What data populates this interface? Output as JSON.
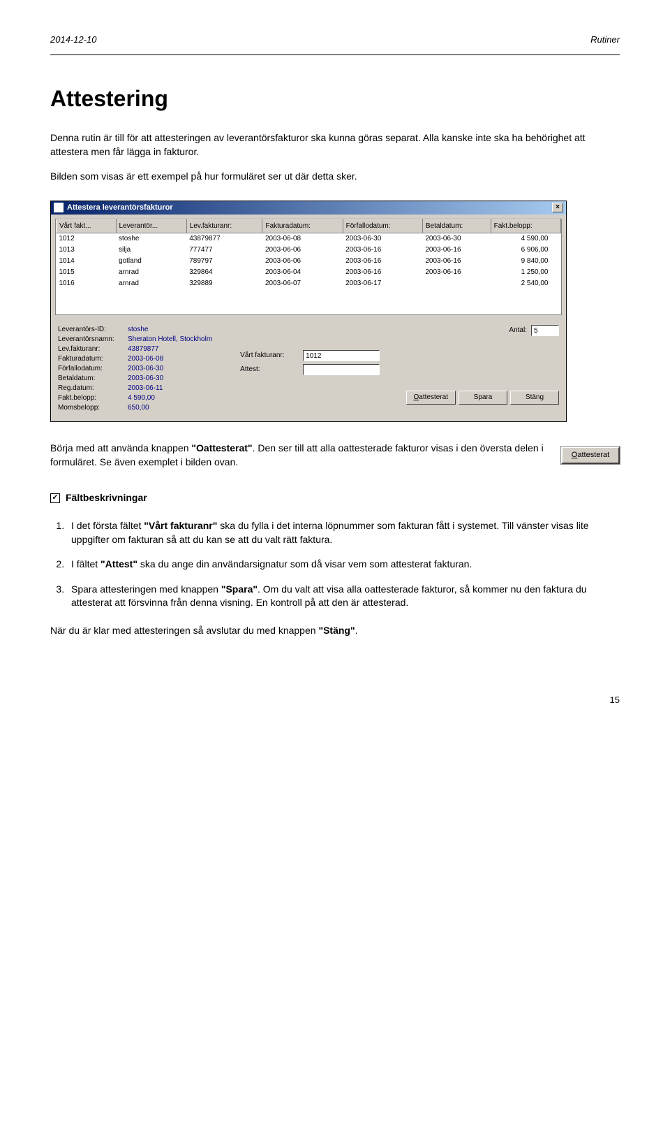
{
  "meta": {
    "date": "2014-12-10",
    "section": "Rutiner",
    "page_number": "15"
  },
  "title": "Attestering",
  "intro": {
    "p1": "Denna rutin är till för att attesteringen av leverantörsfakturor ska kunna göras separat. Alla kanske inte ska ha behörighet att attestera men får lägga in fakturor.",
    "p2": "Bilden som visas är ett exempel på hur formuläret ser ut där detta sker."
  },
  "dialog": {
    "title": "Attestera leverantörsfakturor",
    "columns": [
      "Vårt fakt...",
      "Leverantör...",
      "Lev.fakturanr:",
      "Fakturadatum:",
      "Förfallodatum:",
      "Betaldatum:",
      "Fakt.belopp:"
    ],
    "rows": [
      {
        "vf": "1012",
        "lev": "stoshe",
        "lf": "43879877",
        "fd": "2003-06-08",
        "ffd": "2003-06-30",
        "bd": "2003-06-30",
        "b": "4 590,00"
      },
      {
        "vf": "1013",
        "lev": "silja",
        "lf": "777477",
        "fd": "2003-06-06",
        "ffd": "2003-06-16",
        "bd": "2003-06-16",
        "b": "6 906,00"
      },
      {
        "vf": "1014",
        "lev": "gotland",
        "lf": "789797",
        "fd": "2003-06-06",
        "ffd": "2003-06-16",
        "bd": "2003-06-16",
        "b": "9 840,00"
      },
      {
        "vf": "1015",
        "lev": "arnrad",
        "lf": "329864",
        "fd": "2003-06-04",
        "ffd": "2003-06-16",
        "bd": "2003-06-16",
        "b": "1 250,00"
      },
      {
        "vf": "1016",
        "lev": "arnrad",
        "lf": "329889",
        "fd": "2003-06-07",
        "ffd": "2003-06-17",
        "bd": "",
        "b": "2 540,00"
      }
    ],
    "details": {
      "labels": {
        "lid": "Leverantörs-ID:",
        "lname": "Leverantörsnamn:",
        "lfnr": "Lev.fakturanr:",
        "fdate": "Fakturadatum:",
        "ffdate": "Förfallodatum:",
        "bdate": "Betaldatum:",
        "rdate": "Reg.datum:",
        "fb": "Fakt.belopp:",
        "mb": "Momsbelopp:"
      },
      "values": {
        "lid": "stoshe",
        "lname": "Sheraton Hotell, Stockholm",
        "lfnr": "43879877",
        "fdate": "2003-06-08",
        "ffdate": "2003-06-30",
        "bdate": "2003-06-30",
        "rdate": "2003-06-11",
        "fb": "4 590,00",
        "mb": "650,00"
      }
    },
    "right": {
      "antal_label": "Antal:",
      "antal_value": "5",
      "vf_label": "Vårt fakturanr:",
      "vf_value": "1012",
      "attest_label": "Attest:",
      "attest_value": ""
    },
    "buttons": {
      "oattesterat": "Oattesterat",
      "spara": "Spara",
      "stang": "Stäng"
    }
  },
  "middle": {
    "p1_a": "Börja med att använda knappen ",
    "p1_b": ". Den ser till att alla oattesterade fakturor visas i den översta delen i formuläret. Se även exemplet i bilden ovan.",
    "quoted": "\"Oattesterat\"",
    "inline_button": "Oattesterat"
  },
  "fieldhd": "Fältbeskrivningar",
  "list": {
    "i1_a": "I det första fältet ",
    "i1_b": " ska du fylla i det interna löpnummer som fakturan fått i systemet. Till vänster visas lite uppgifter om fakturan så att du kan se att du valt rätt faktura.",
    "i1_q": "\"Vårt fakturanr\"",
    "i2_a": "I fältet ",
    "i2_b": " ska du ange din användarsignatur som då visar vem som attesterat fakturan.",
    "i2_q": "\"Attest\"",
    "i3_a": "Spara attesteringen med knappen ",
    "i3_b": ". Om du valt att visa alla oattesterade fakturor, så kommer nu den faktura du attesterat att försvinna från denna visning. En kontroll på att den är attesterad.",
    "i3_q": "\"Spara\""
  },
  "closing_a": "När du är klar med attesteringen så avslutar du med knappen ",
  "closing_q": "\"Stäng\"",
  "closing_b": "."
}
